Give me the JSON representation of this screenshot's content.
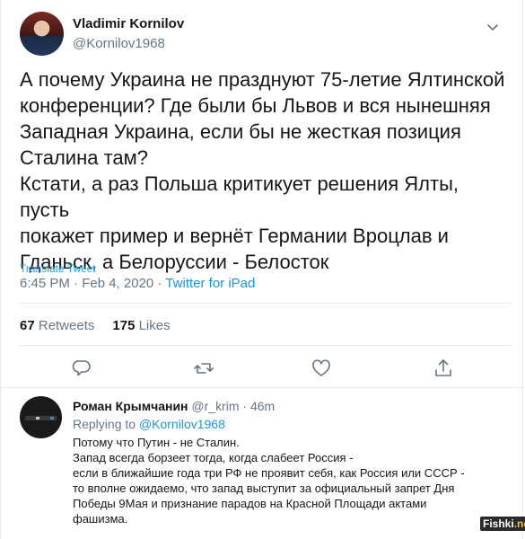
{
  "tweet": {
    "author_name": "Vladimir Kornilov",
    "author_handle": "@Kornilov1968",
    "text_lines": [
      "А почему Украина не празднуют 75-летие Ялтинской",
      "конференции? Где были бы Львов и вся нынешняя",
      "Западная Украина, если бы не жесткая позиция",
      "Сталина там?",
      "Кстати, а раз Польша критикует решения Ялты, пусть",
      "покажет пример и вернёт Германии Вроцлав и",
      "Гданьск, а Белоруссии - Белосток"
    ],
    "translate_label": "Translate Tweet",
    "time": "6:45 PM · Feb 4, 2020 · ",
    "client": "Twitter for iPad",
    "retweets_count": "67",
    "retweets_label": "Retweets",
    "likes_count": "175",
    "likes_label": "Likes"
  },
  "actions": [
    "reply-icon",
    "retweet-icon",
    "like-icon",
    "share-icon"
  ],
  "reply": {
    "author_name": "Роман Крымчанин",
    "author_handle": "@r_krim",
    "age": " · 46m",
    "replying_prefix": "Replying to ",
    "replying_to": "@Kornilov1968",
    "text_lines": [
      "Потому что Путин - не Сталин.",
      "Запад всегда борзеет тогда, когда слабеет Россия -",
      "если в ближайшие года три РФ не проявит себя, как Россия или СССР -",
      "то вполне ожидаемо, что запад выступит за официальный запрет Дня",
      "Победы 9Мая и признание парадов на Красной Площади актами",
      "фашизма."
    ]
  },
  "watermark": {
    "text": "Fishki",
    "suffix": ".net"
  },
  "colors": {
    "accent": "#1da1f2",
    "link": "#1b95e0",
    "secondary_text": "#657786",
    "primary_text": "#14171a",
    "divider": "#e6ecf0"
  }
}
